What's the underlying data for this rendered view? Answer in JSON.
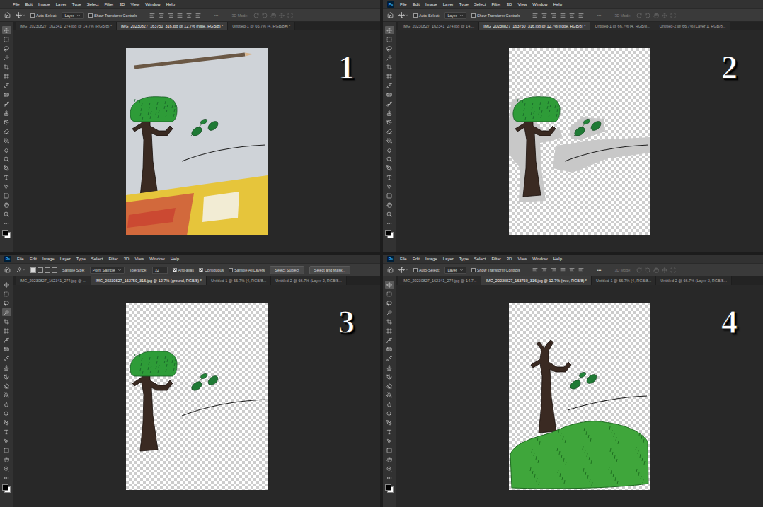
{
  "menu": [
    "File",
    "Edit",
    "Image",
    "Layer",
    "Type",
    "Select",
    "Filter",
    "3D",
    "View",
    "Window",
    "Help"
  ],
  "panels": [
    {
      "number": "1",
      "tools": [
        {
          "selected": true
        },
        {
          "selected": false
        },
        {
          "selected": false
        },
        {
          "selected": false
        },
        {
          "selected": false
        },
        {
          "selected": false
        },
        {
          "selected": false
        },
        {
          "selected": false
        },
        {
          "selected": false
        },
        {
          "selected": false
        },
        {
          "selected": false
        },
        {
          "selected": false
        },
        {
          "selected": false
        },
        {
          "selected": false
        },
        {
          "selected": false
        },
        {
          "selected": false
        },
        {
          "selected": false
        },
        {
          "selected": false
        },
        {
          "selected": false
        },
        {
          "selected": false
        },
        {
          "selected": false
        },
        {
          "selected": false
        }
      ],
      "options": {
        "kind": "move",
        "items": [
          {
            "kind": "checkbox",
            "label": "Auto-Select:",
            "checked": false
          },
          {
            "kind": "dropdown",
            "label": "Layer"
          },
          {
            "kind": "checkbox",
            "label": "Show Transform Controls",
            "checked": false
          },
          {
            "kind": "more",
            "label": "•••"
          },
          {
            "kind": "dim",
            "label": "3D Mode:"
          }
        ]
      },
      "tabs": [
        {
          "label": "IMG_20230827_162341_274.jpg @ 14.7% (RGB/8) *",
          "selected": false
        },
        {
          "label": "IMG_20230827_163750_316.jpg @ 12.7% (rope, RGB/8) *",
          "selected": true
        },
        {
          "label": "Untitled-1 @ 66.7% (4, RGB/8#) *",
          "selected": false
        }
      ],
      "canvas": {
        "kind": "photo"
      }
    },
    {
      "number": "2",
      "logo": "Ps",
      "tools": [
        {
          "selected": true
        },
        {
          "selected": false
        },
        {
          "selected": false
        },
        {
          "selected": false
        },
        {
          "selected": false
        },
        {
          "selected": false
        },
        {
          "selected": false
        },
        {
          "selected": false
        },
        {
          "selected": false
        },
        {
          "selected": false
        },
        {
          "selected": false
        },
        {
          "selected": false
        },
        {
          "selected": false
        },
        {
          "selected": false
        },
        {
          "selected": false
        },
        {
          "selected": false
        },
        {
          "selected": false
        },
        {
          "selected": false
        },
        {
          "selected": false
        },
        {
          "selected": false
        },
        {
          "selected": false
        },
        {
          "selected": false
        }
      ],
      "options": {
        "kind": "move",
        "items": [
          {
            "kind": "checkbox",
            "label": "Auto-Select:",
            "checked": false
          },
          {
            "kind": "dropdown",
            "label": "Layer"
          },
          {
            "kind": "checkbox",
            "label": "Show Transform Controls",
            "checked": false
          },
          {
            "kind": "more",
            "label": "•••"
          },
          {
            "kind": "dim",
            "label": "3D Mode:"
          }
        ]
      },
      "tabs": [
        {
          "label": "IMG_20230827_162341_274.jpg @ 14....",
          "selected": false
        },
        {
          "label": "IMG_20230827_163750_316.jpg @ 12.7% (rope, RGB/8) *",
          "selected": true
        },
        {
          "label": "Untitled-1 @ 66.7% (4, RGB/8...",
          "selected": false
        },
        {
          "label": "Untitled-2 @ 66.7% (Layer 1, RGB/8...",
          "selected": false
        }
      ],
      "canvas": {
        "kind": "halo"
      }
    },
    {
      "number": "3",
      "logo": "Ps",
      "tools": [
        {
          "selected": false
        },
        {
          "selected": false
        },
        {
          "selected": false
        },
        {
          "selected": true
        },
        {
          "selected": false
        },
        {
          "selected": false
        },
        {
          "selected": false
        },
        {
          "selected": false
        },
        {
          "selected": false
        },
        {
          "selected": false
        },
        {
          "selected": false
        },
        {
          "selected": false
        },
        {
          "selected": false
        },
        {
          "selected": false
        },
        {
          "selected": false
        },
        {
          "selected": false
        },
        {
          "selected": false
        },
        {
          "selected": false
        },
        {
          "selected": false
        },
        {
          "selected": false
        },
        {
          "selected": false
        },
        {
          "selected": false
        }
      ],
      "options": {
        "kind": "wand",
        "modes": [
          {
            "selected": true
          },
          {
            "selected": false
          },
          {
            "selected": false
          },
          {
            "selected": false
          }
        ],
        "items": [
          {
            "kind": "label",
            "label": "Sample Size:"
          },
          {
            "kind": "dropdown",
            "label": "Point Sample"
          },
          {
            "kind": "label",
            "label": "Tolerance:"
          },
          {
            "kind": "input",
            "label": "32"
          },
          {
            "kind": "checkbox",
            "label": "Anti-alias",
            "checked": true
          },
          {
            "kind": "checkbox",
            "label": "Contiguous",
            "checked": true
          },
          {
            "kind": "checkbox",
            "label": "Sample All Layers",
            "checked": false
          },
          {
            "kind": "button",
            "label": "Select Subject"
          },
          {
            "kind": "button",
            "label": "Select and Mask..."
          }
        ]
      },
      "tabs": [
        {
          "label": "IMG_20230827_162341_274.jpg @ ...",
          "selected": false
        },
        {
          "label": "IMG_20230827_163750_316.jpg @ 12.7% (ground, RGB/8) *",
          "selected": true
        },
        {
          "label": "Untitled-1 @ 66.7% (4, RGB/8...",
          "selected": false
        },
        {
          "label": "Untitled-2 @ 66.7% (Layer 2, RGB/8...",
          "selected": false
        }
      ],
      "canvas": {
        "kind": "cutout"
      }
    },
    {
      "number": "4",
      "logo": "Ps",
      "tools": [
        {
          "selected": true
        },
        {
          "selected": false
        },
        {
          "selected": false
        },
        {
          "selected": false
        },
        {
          "selected": false
        },
        {
          "selected": false
        },
        {
          "selected": false
        },
        {
          "selected": false
        },
        {
          "selected": false
        },
        {
          "selected": false
        },
        {
          "selected": false
        },
        {
          "selected": false
        },
        {
          "selected": false
        },
        {
          "selected": false
        },
        {
          "selected": false
        },
        {
          "selected": false
        },
        {
          "selected": false
        },
        {
          "selected": false
        },
        {
          "selected": false
        },
        {
          "selected": false
        },
        {
          "selected": false
        },
        {
          "selected": false
        }
      ],
      "options": {
        "kind": "move",
        "items": [
          {
            "kind": "checkbox",
            "label": "Auto-Select:",
            "checked": false
          },
          {
            "kind": "dropdown",
            "label": "Layer"
          },
          {
            "kind": "checkbox",
            "label": "Show Transform Controls",
            "checked": false
          },
          {
            "kind": "more",
            "label": "•••"
          },
          {
            "kind": "dim",
            "label": "3D Mode:"
          }
        ]
      },
      "tabs": [
        {
          "label": "IMG_20230827_162341_274.jpg @ 14.7...",
          "selected": false
        },
        {
          "label": "IMG_20230827_163750_316.jpg @ 12.7% (tree, RGB/8) *",
          "selected": true
        },
        {
          "label": "Untitled-1 @ 66.7% (4, RGB/8...",
          "selected": false
        },
        {
          "label": "Untitled-2 @ 66.7% (Layer 3, RGB/8...",
          "selected": false
        }
      ],
      "canvas": {
        "kind": "scene"
      }
    }
  ]
}
